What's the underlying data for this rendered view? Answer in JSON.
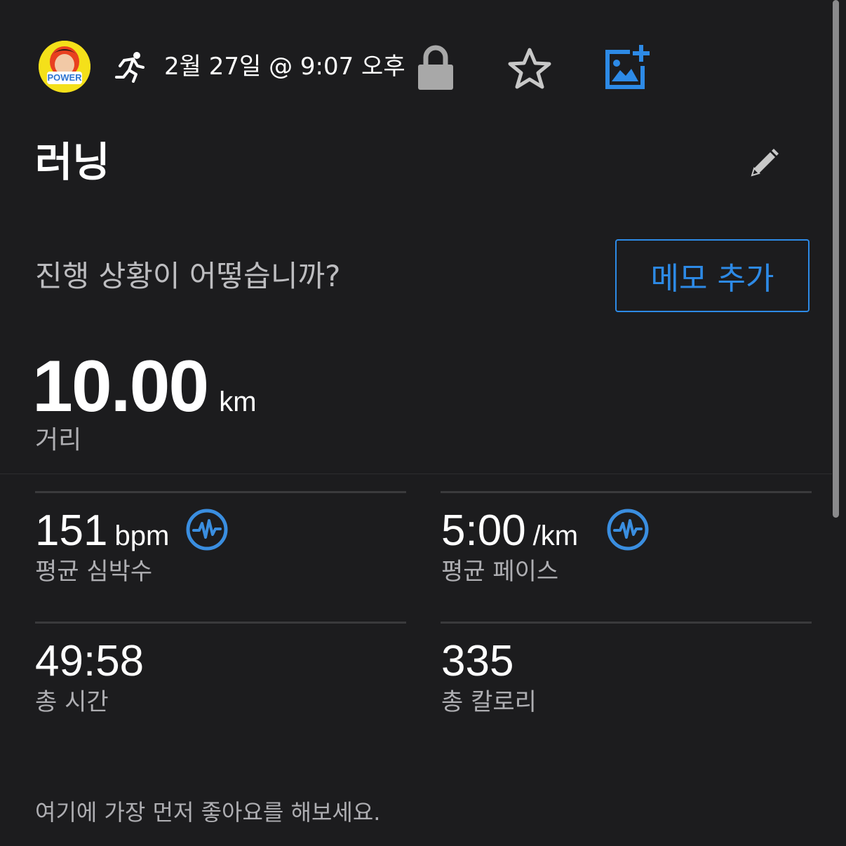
{
  "header": {
    "date_time": "2월 27일 @ 9:07 오후",
    "avatar_text": "POWER",
    "icons": [
      "avatar",
      "running-activity-icon",
      "lock-icon",
      "star-icon",
      "add-photo-icon"
    ]
  },
  "activity": {
    "title": "러닝"
  },
  "note": {
    "prompt": "진행 상황이 어떻습니까?",
    "button_label": "메모 추가"
  },
  "distance": {
    "value": "10.00",
    "unit": "km",
    "label": "거리"
  },
  "stats": [
    {
      "value": "151",
      "unit": "bpm",
      "label": "평균 심박수",
      "icon": "heart-rate-icon"
    },
    {
      "value": "5:00",
      "unit": "/km",
      "label": "평균 페이스",
      "icon": "heart-rate-icon"
    },
    {
      "value": "49:58",
      "unit": "",
      "label": "총 시간"
    },
    {
      "value": "335",
      "unit": "",
      "label": "총 칼로리"
    }
  ],
  "footer": {
    "text": "여기에 가장 먼저 좋아요를 해보세요."
  },
  "colors": {
    "background": "#1c1c1e",
    "accent": "#2d8ae6",
    "secondary_text": "#aeaeb2"
  }
}
